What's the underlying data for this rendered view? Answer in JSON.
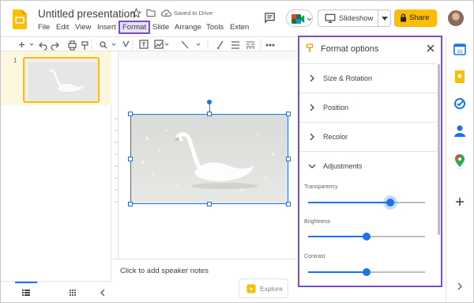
{
  "header": {
    "title": "Untitled presentation",
    "saved_status": "Saved to Drive",
    "slideshow_label": "Slideshow",
    "share_label": "Share"
  },
  "menu": [
    "File",
    "Edit",
    "View",
    "Insert",
    "Format",
    "Slide",
    "Arrange",
    "Tools",
    "Exten"
  ],
  "filmstrip": {
    "slide_number": "1"
  },
  "notes": {
    "placeholder": "Click to add speaker notes"
  },
  "explore_label": "Explore",
  "format_panel": {
    "title": "Format options",
    "sections": [
      {
        "label": "Size & Rotation",
        "expanded": false
      },
      {
        "label": "Position",
        "expanded": false
      },
      {
        "label": "Recolor",
        "expanded": false
      },
      {
        "label": "Adjustments",
        "expanded": true
      }
    ],
    "sliders": [
      {
        "label": "Transparency",
        "value": 0.7
      },
      {
        "label": "Brightness",
        "value": 0.5
      },
      {
        "label": "Contrast",
        "value": 0.5
      }
    ]
  },
  "colors": {
    "accent": "#1a73e8",
    "share": "#fbbc04",
    "highlight": "#7c4dcc"
  }
}
